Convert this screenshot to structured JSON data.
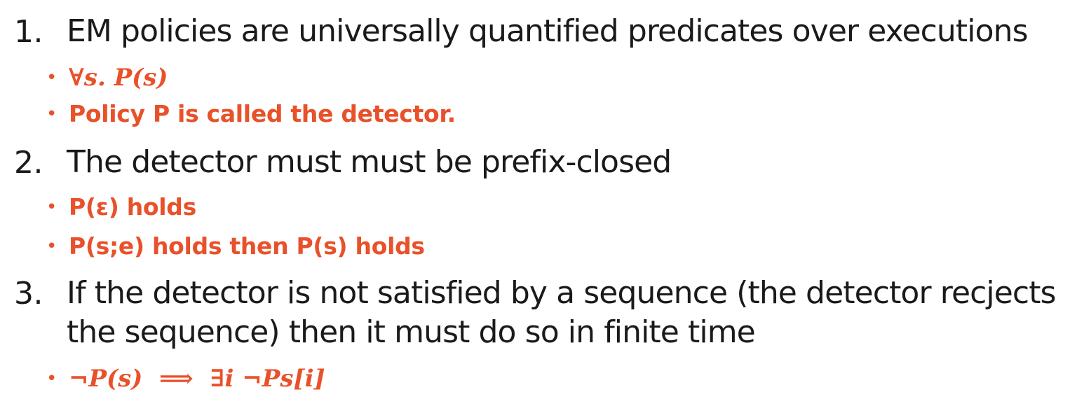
{
  "items": [
    {
      "number": "1.",
      "text": "EM policies are universally quantified predicates over executions",
      "subs": [
        "∀s. P(s)",
        "Policy P is called the detector."
      ]
    },
    {
      "number": "2.",
      "text": "The detector must must be prefix-closed",
      "subs": [
        "P(ε) holds",
        "P(s;e) holds then P(s) holds"
      ]
    },
    {
      "number": "3.",
      "text_line1": "If the detector is not satisfied by a sequence (the detector recjects",
      "text_line2": "the sequence) then it must do so in finite time",
      "subs": [
        "¬P(s)  ⟹  ∃i ¬Ps[i]"
      ]
    }
  ],
  "bullet_glyph": "•",
  "colors": {
    "text": "#1a1a1a",
    "accent": "#e8512a",
    "background": "#ffffff"
  }
}
